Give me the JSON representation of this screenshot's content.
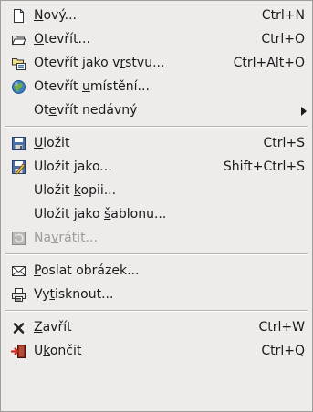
{
  "menu": {
    "items": [
      {
        "key": "new",
        "pre": "",
        "mnemonic": "N",
        "post": "ový...",
        "accel": "Ctrl+N",
        "icon": "new-document-icon"
      },
      {
        "key": "open",
        "pre": "",
        "mnemonic": "O",
        "post": "tevřít...",
        "accel": "Ctrl+O",
        "icon": "folder-open-icon"
      },
      {
        "key": "open-as-layers",
        "pre": "Otevřít jako v",
        "mnemonic": "r",
        "post": "stvu...",
        "accel": "Ctrl+Alt+O",
        "icon": "open-as-layers-icon"
      },
      {
        "key": "open-location",
        "pre": "Otevřít ",
        "mnemonic": "u",
        "post": "místění...",
        "accel": "",
        "icon": "globe-icon"
      },
      {
        "key": "open-recent",
        "pre": "Ot",
        "mnemonic": "e",
        "post": "vřít nedávný",
        "accel": "",
        "icon": "",
        "submenu": true
      },
      {
        "key": "save",
        "pre": "",
        "mnemonic": "U",
        "post": "ložit",
        "accel": "Ctrl+S",
        "icon": "save-icon"
      },
      {
        "key": "save-as",
        "pre": "Uložit ",
        "mnemonic": "j",
        "post": "ako...",
        "accel": "Shift+Ctrl+S",
        "icon": "save-as-icon"
      },
      {
        "key": "save-copy",
        "pre": "Uložit ",
        "mnemonic": "k",
        "post": "opii...",
        "accel": "",
        "icon": ""
      },
      {
        "key": "save-as-template",
        "pre": "Uložit jako ",
        "mnemonic": "š",
        "post": "ablonu...",
        "accel": "",
        "icon": ""
      },
      {
        "key": "revert",
        "pre": "Na",
        "mnemonic": "v",
        "post": "rátit...",
        "accel": "",
        "icon": "revert-icon",
        "disabled": true
      },
      {
        "key": "send-image",
        "pre": "",
        "mnemonic": "P",
        "post": "oslat obrázek...",
        "accel": "",
        "icon": "mail-icon"
      },
      {
        "key": "print",
        "pre": "Vy",
        "mnemonic": "t",
        "post": "isknout...",
        "accel": "",
        "icon": "print-icon"
      },
      {
        "key": "close",
        "pre": "",
        "mnemonic": "Z",
        "post": "avřít",
        "accel": "Ctrl+W",
        "icon": "close-icon"
      },
      {
        "key": "quit",
        "pre": "U",
        "mnemonic": "k",
        "post": "ončit",
        "accel": "Ctrl+Q",
        "icon": "quit-icon"
      }
    ]
  }
}
